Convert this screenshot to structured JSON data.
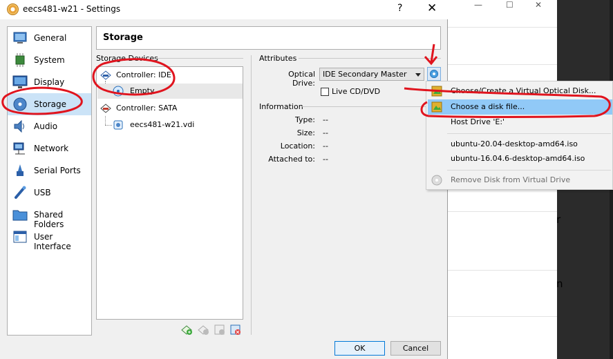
{
  "window": {
    "title": "eecs481-w21 - Settings",
    "help": "?",
    "close": "✕"
  },
  "background": {
    "minimize": "—",
    "maximize": "☐",
    "close": "✕",
    "letter_r": "r",
    "letter_n": "n"
  },
  "sidebar": {
    "items": [
      {
        "label": "General",
        "icon": "general-icon"
      },
      {
        "label": "System",
        "icon": "chip-icon"
      },
      {
        "label": "Display",
        "icon": "monitor-icon"
      },
      {
        "label": "Storage",
        "icon": "disk-icon",
        "selected": true
      },
      {
        "label": "Audio",
        "icon": "speaker-icon"
      },
      {
        "label": "Network",
        "icon": "network-icon"
      },
      {
        "label": "Serial Ports",
        "icon": "serial-port-icon"
      },
      {
        "label": "USB",
        "icon": "usb-icon"
      },
      {
        "label": "Shared Folders",
        "icon": "folder-icon"
      },
      {
        "label": "User Interface",
        "icon": "window-icon"
      }
    ]
  },
  "header": {
    "title": "Storage"
  },
  "storage_devices": {
    "label": "Storage Devices",
    "tree": [
      {
        "label": "Controller: IDE",
        "icon": "ide-controller-icon"
      },
      {
        "label": "Empty",
        "icon": "cd-icon",
        "selected": true
      },
      {
        "label": "Controller: SATA",
        "icon": "sata-controller-icon"
      },
      {
        "label": "eecs481-w21.vdi",
        "icon": "hard-disk-icon"
      }
    ]
  },
  "attributes": {
    "label": "Attributes",
    "optical_drive_label": "Optical Drive:",
    "optical_drive_value": "IDE Secondary Master",
    "live_cd_label": "Live CD/DVD"
  },
  "information": {
    "label": "Information",
    "rows": [
      {
        "label": "Type:",
        "value": "--"
      },
      {
        "label": "Size:",
        "value": "--"
      },
      {
        "label": "Location:",
        "value": "--"
      },
      {
        "label": "Attached to:",
        "value": "--"
      }
    ]
  },
  "buttons": {
    "ok": "OK",
    "cancel": "Cancel"
  },
  "menu": {
    "items": [
      {
        "label": "Choose/Create a Virtual Optical Disk...",
        "icon": "optical-disk-icon"
      },
      {
        "label": "Choose a disk file...",
        "icon": "optical-disk-file-icon",
        "highlighted": true
      },
      {
        "label": "Host Drive 'E:'"
      },
      {
        "label": "ubuntu-20.04-desktop-amd64.iso"
      },
      {
        "label": "ubuntu-16.04.6-desktop-amd64.iso"
      },
      {
        "label": "Remove Disk from Virtual Drive",
        "icon": "remove-disk-icon",
        "disabled": true
      }
    ]
  },
  "colors": {
    "selection": "#cbe3f7",
    "menu_highlight": "#91c9f7",
    "annotation_red": "#e0141e"
  }
}
